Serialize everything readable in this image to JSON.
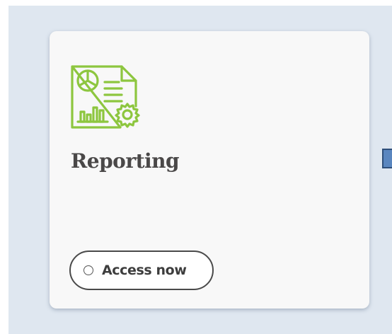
{
  "card": {
    "icon": "report-document-chart-gear-icon",
    "title": "Reporting",
    "button_label": "Access now"
  },
  "colors": {
    "background_panel": "#dfe7f0",
    "card_background": "#f8f8f8",
    "icon_green": "#8dc63f",
    "title_text": "#4a4848",
    "edge_handle": "#5a86bf"
  }
}
